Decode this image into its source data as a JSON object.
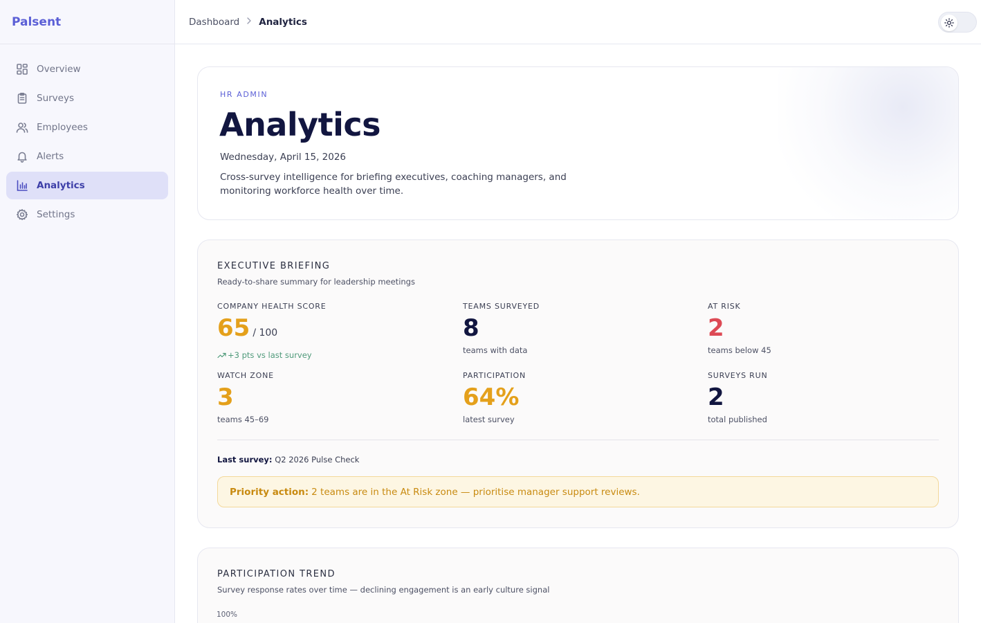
{
  "brand": "Palsent",
  "sidebar": {
    "items": [
      {
        "label": "Overview",
        "icon": "grid-icon"
      },
      {
        "label": "Surveys",
        "icon": "clipboard-icon"
      },
      {
        "label": "Employees",
        "icon": "users-icon"
      },
      {
        "label": "Alerts",
        "icon": "bell-icon"
      },
      {
        "label": "Analytics",
        "icon": "bar-chart-icon",
        "active": true
      },
      {
        "label": "Settings",
        "icon": "gear-icon"
      }
    ]
  },
  "header": {
    "breadcrumb_root": "Dashboard",
    "breadcrumb_current": "Analytics"
  },
  "hero": {
    "eyebrow": "HR ADMIN",
    "title": "Analytics",
    "date": "Wednesday, April 15, 2026",
    "description": "Cross-survey intelligence for briefing executives, coaching managers, and monitoring workforce health over time."
  },
  "briefing": {
    "title": "EXECUTIVE BRIEFING",
    "subtitle": "Ready-to-share summary for leadership meetings",
    "stats": {
      "health": {
        "label": "COMPANY HEALTH SCORE",
        "value": "65",
        "unit": "/ 100",
        "note": "+3 pts vs last survey"
      },
      "teams": {
        "label": "TEAMS SURVEYED",
        "value": "8",
        "note": "teams with data"
      },
      "at_risk": {
        "label": "AT RISK",
        "value": "2",
        "note": "teams below 45"
      },
      "watch": {
        "label": "WATCH ZONE",
        "value": "3",
        "note": "teams 45–69"
      },
      "participation": {
        "label": "PARTICIPATION",
        "value": "64%",
        "note": "latest survey"
      },
      "surveys": {
        "label": "SURVEYS RUN",
        "value": "2",
        "note": "total published"
      }
    },
    "last_survey_label": "Last survey:",
    "last_survey_value": "Q2 2026 Pulse Check",
    "priority_label": "Priority action:",
    "priority_text": "2 teams are in the At Risk zone — prioritise manager support reviews."
  },
  "trend": {
    "title": "PARTICIPATION TREND",
    "subtitle": "Survey response rates over time — declining engagement is an early culture signal",
    "y_top_label": "100%"
  },
  "colors": {
    "accent": "#5b5fd6",
    "amber": "#e4a01b",
    "navy": "#121640",
    "red": "#dd4a55",
    "green": "#4f9a7a"
  }
}
